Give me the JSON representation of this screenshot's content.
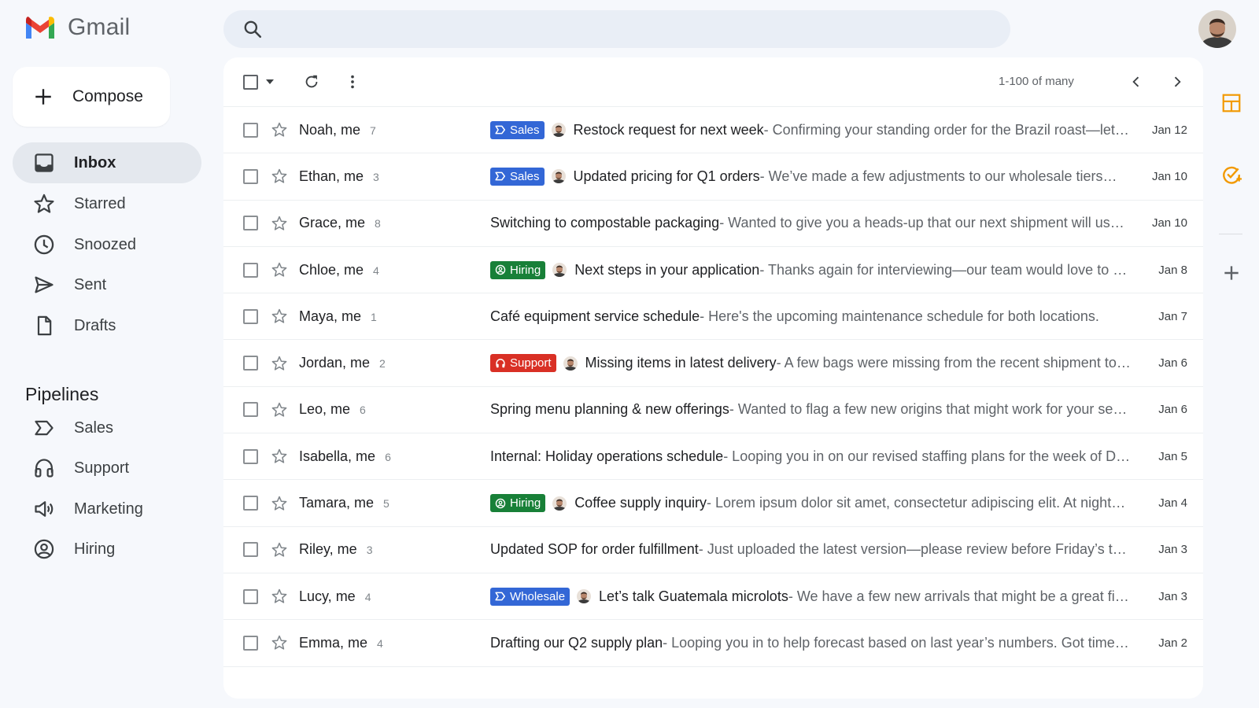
{
  "app": {
    "name": "Gmail"
  },
  "search": {
    "placeholder": ""
  },
  "compose": {
    "label": "Compose"
  },
  "nav": [
    {
      "label": "Inbox",
      "icon": "inbox-icon",
      "active": true
    },
    {
      "label": "Starred",
      "icon": "star-icon"
    },
    {
      "label": "Snoozed",
      "icon": "clock-icon"
    },
    {
      "label": "Sent",
      "icon": "send-icon"
    },
    {
      "label": "Drafts",
      "icon": "draft-icon"
    }
  ],
  "pipelines": {
    "title": "Pipelines",
    "items": [
      {
        "label": "Sales",
        "icon": "label-arrow-icon"
      },
      {
        "label": "Support",
        "icon": "headset-icon"
      },
      {
        "label": "Marketing",
        "icon": "megaphone-icon"
      },
      {
        "label": "Hiring",
        "icon": "person-circle-icon"
      }
    ]
  },
  "toolbar": {
    "pager": "1-100 of many"
  },
  "colors": {
    "sales": "#3367d6",
    "hiring": "#188038",
    "support": "#d93025",
    "wholesale": "#3367d6",
    "brand_red": "#ea4335"
  },
  "emails": [
    {
      "sender": "Noah, me",
      "count": "7",
      "chip": "Sales",
      "chip_type": "sales",
      "avatar": true,
      "subject": "Restock request for next week",
      "snippet": " - Confirming your standing order for the Brazil roast—let us know if you need any changes",
      "date": "Jan 12"
    },
    {
      "sender": "Ethan, me",
      "count": "3",
      "chip": "Sales",
      "chip_type": "sales",
      "avatar": true,
      "subject": "Updated pricing for Q1 orders",
      "snippet": " - We’ve made a few adjustments to our wholesale tiers—see the attached sheet",
      "date": "Jan 10"
    },
    {
      "sender": "Grace, me",
      "count": "8",
      "chip": "",
      "chip_type": "",
      "avatar": false,
      "subject": "Switching to compostable packaging",
      "snippet": " - Wanted to give you a heads-up that our next shipment will use the new bags",
      "date": "Jan 10"
    },
    {
      "sender": "Chloe, me",
      "count": "4",
      "chip": "Hiring",
      "chip_type": "hiring",
      "avatar": true,
      "subject": "Next steps in your application",
      "snippet": " - Thanks again for interviewing—our team would love to set up a tasting",
      "date": "Jan 8"
    },
    {
      "sender": "Maya, me",
      "count": "1",
      "chip": "",
      "chip_type": "",
      "avatar": false,
      "subject": "Café equipment service schedule",
      "snippet": " - Here's the upcoming maintenance schedule for both locations.",
      "date": "Jan 7"
    },
    {
      "sender": "Jordan, me",
      "count": "2",
      "chip": "Support",
      "chip_type": "support",
      "avatar": true,
      "subject": "Missing items in latest delivery",
      "snippet": " - A few bags were missing from the recent shipment to our downtown store",
      "date": "Jan 6"
    },
    {
      "sender": "Leo, me",
      "count": "6",
      "chip": "",
      "chip_type": "",
      "avatar": false,
      "subject": "Spring menu planning & new offerings",
      "snippet": " - Wanted to flag a few new origins that might work for your seasonal menu",
      "date": "Jan 6"
    },
    {
      "sender": "Isabella, me",
      "count": "6",
      "chip": "",
      "chip_type": "",
      "avatar": false,
      "subject": "Internal: Holiday operations schedule",
      "snippet": " - Looping you in on our revised staffing plans for the week of December",
      "date": "Jan 5"
    },
    {
      "sender": "Tamara, me",
      "count": "5",
      "chip": "Hiring",
      "chip_type": "hiring",
      "avatar": true,
      "subject": "Coffee supply inquiry",
      "snippet": " - Lorem ipsum dolor sit amet, consectetur adipiscing elit. At nights we roast",
      "date": "Jan 4"
    },
    {
      "sender": "Riley, me",
      "count": "3",
      "chip": "",
      "chip_type": "",
      "avatar": false,
      "subject": "Updated SOP for order fulfillment",
      "snippet": " - Just uploaded the latest version—please review before Friday’s training session",
      "date": "Jan 3"
    },
    {
      "sender": "Lucy, me",
      "count": "4",
      "chip": "Wholesale",
      "chip_type": "wholesale",
      "avatar": true,
      "subject": "Let’s talk Guatemala microlots",
      "snippet": " - We have a few new arrivals that might be a great fit for your blends",
      "date": "Jan 3"
    },
    {
      "sender": "Emma, me",
      "count": "4",
      "chip": "",
      "chip_type": "",
      "avatar": false,
      "subject": "Drafting our Q2 supply plan",
      "snippet": " - Looping you in to help forecast based on last year’s numbers. Got time this week",
      "date": "Jan 2"
    }
  ],
  "rail": [
    {
      "icon": "layout-icon",
      "color": "#f29900"
    },
    {
      "icon": "task-icon",
      "color": "#f29900"
    },
    {
      "icon": "add-icon",
      "color": "#5f6368"
    }
  ]
}
